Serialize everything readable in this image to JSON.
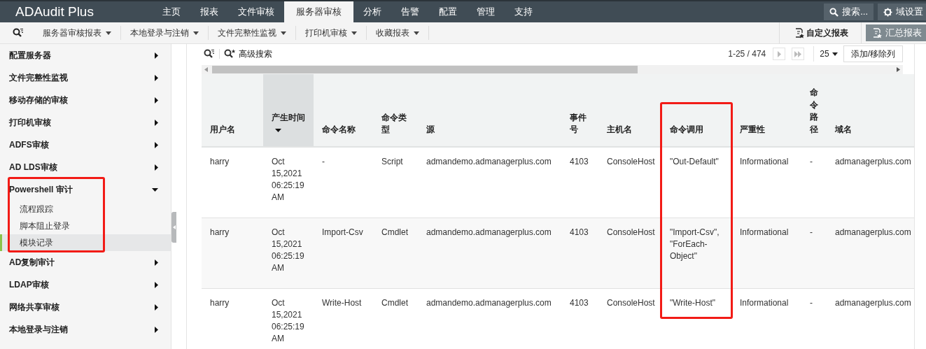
{
  "app": {
    "logo": "ADAudit Plus"
  },
  "nav_tabs": [
    {
      "label": "主页",
      "selected": false
    },
    {
      "label": "报表",
      "selected": false
    },
    {
      "label": "文件审核",
      "selected": false
    },
    {
      "label": "服务器审核",
      "selected": true
    },
    {
      "label": "分析",
      "selected": false
    },
    {
      "label": "告警",
      "selected": false
    },
    {
      "label": "配置",
      "selected": false
    },
    {
      "label": "管理",
      "selected": false
    },
    {
      "label": "支持",
      "selected": false
    }
  ],
  "header_actions": {
    "search": "搜索...",
    "domain_settings": "域设置"
  },
  "toolbar": {
    "menus": [
      "服务器审核报表",
      "本地登录与注销",
      "文件完整性监视",
      "打印机审核",
      "收藏报表"
    ],
    "custom_report": "自定义报表",
    "summary_report": "汇总报表"
  },
  "sidebar": {
    "items": [
      {
        "label": "配置服务器",
        "expanded": false
      },
      {
        "label": "文件完整性监视",
        "expanded": false
      },
      {
        "label": "移动存储的审核",
        "expanded": false
      },
      {
        "label": "打印机审核",
        "expanded": false
      },
      {
        "label": "ADFS审核",
        "expanded": false
      },
      {
        "label": "AD LDS审核",
        "expanded": false
      },
      {
        "label": "Powershell 审计",
        "expanded": true,
        "annotated": true,
        "children": [
          {
            "label": "流程跟踪",
            "selected": false
          },
          {
            "label": "脚本阻止登录",
            "selected": false
          },
          {
            "label": "模块记录",
            "selected": true
          }
        ]
      },
      {
        "label": "AD复制审计",
        "expanded": false
      },
      {
        "label": "LDAP审核",
        "expanded": false
      },
      {
        "label": "网络共享审核",
        "expanded": false
      },
      {
        "label": "本地登录与注销",
        "expanded": false
      }
    ]
  },
  "report": {
    "advanced_search": "高级搜索",
    "page_range": "1-25 / 474",
    "page_size": "25",
    "columns_button": "添加/移除列"
  },
  "table": {
    "columns": [
      {
        "label": "用户名",
        "sorted": false
      },
      {
        "label": "产生时间",
        "sorted": true
      },
      {
        "label": "命令名称",
        "sorted": false
      },
      {
        "label": "命令类型",
        "sorted": false
      },
      {
        "label": "源",
        "sorted": false
      },
      {
        "label": "事件号",
        "sorted": false
      },
      {
        "label": "主机名",
        "sorted": false
      },
      {
        "label": "命令调用",
        "sorted": false,
        "annotated": true
      },
      {
        "label": "严重性",
        "sorted": false
      },
      {
        "label": "命令路径",
        "sorted": false,
        "vertical": true
      },
      {
        "label": "域名",
        "sorted": false
      }
    ],
    "rows": [
      [
        "harry",
        "Oct 15,2021 06:25:19 AM",
        "-",
        "Script",
        "admandemo.admanagerplus.com",
        "4103",
        "ConsoleHost",
        "\"Out-Default\"",
        "Informational",
        "-",
        "admanagerplus.com"
      ],
      [
        "harry",
        "Oct 15,2021 06:25:19 AM",
        "Import-Csv",
        "Cmdlet",
        "admandemo.admanagerplus.com",
        "4103",
        "ConsoleHost",
        "\"Import-Csv\", \"ForEach-Object\"",
        "Informational",
        "-",
        "admanagerplus.com"
      ],
      [
        "harry",
        "Oct 15,2021 06:25:19 AM",
        "Write-Host",
        "Cmdlet",
        "admandemo.admanagerplus.com",
        "4103",
        "ConsoleHost",
        "\"Write-Host\"",
        "Informational",
        "-",
        "admanagerplus.com"
      ]
    ]
  }
}
